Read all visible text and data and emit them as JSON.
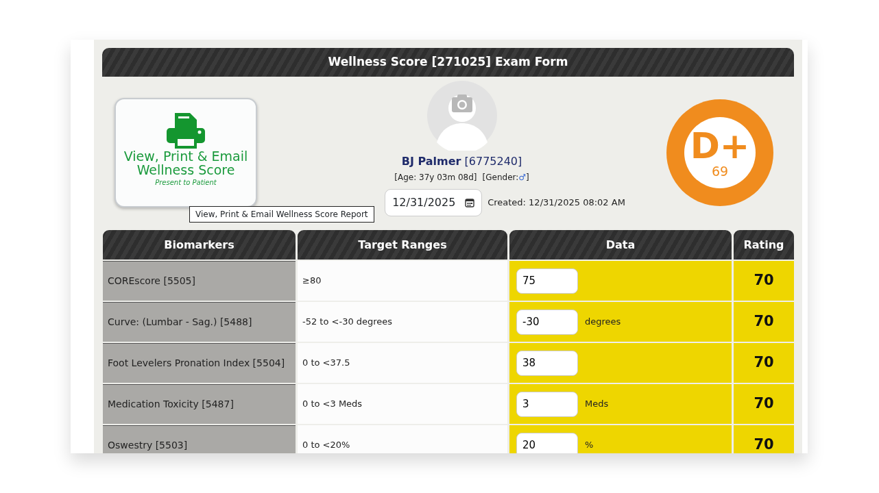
{
  "form_title": "Wellness Score [271025] Exam Form",
  "report_button": {
    "title": "View, Print & Email Wellness Score",
    "subtitle": "Present to Patient"
  },
  "tooltip": "View, Print & Email Wellness Score Report",
  "patient": {
    "name": "BJ Palmer",
    "id": "[6775240]",
    "age": "[Age: 37y 03m 08d]",
    "gender_prefix": "[Gender:",
    "gender_symbol": "♂",
    "gender_suffix": "]"
  },
  "exam_date": {
    "value": "12/31/2025"
  },
  "created": "Created: 12/31/2025 08:02 AM",
  "grade": {
    "letter": "D+",
    "score": "69",
    "color": "#f08c1e"
  },
  "table": {
    "columns": [
      "Biomarkers",
      "Target Ranges",
      "Data",
      "Rating"
    ],
    "rows": [
      {
        "biomarker": "COREscore [5505]",
        "target": "≥80",
        "value": "75",
        "rating": "70",
        "color": "#eed600"
      },
      {
        "biomarker": "Curve: (Lumbar - Sag.) [5488]",
        "target": "-52 to <-30 degrees",
        "value": "-30",
        "unit": "degrees",
        "rating": "70",
        "color": "#eed600"
      },
      {
        "biomarker": "Foot Levelers Pronation Index [5504]",
        "target": "0 to <37.5",
        "value": "38",
        "rating": "70",
        "color": "#eed600"
      },
      {
        "biomarker": "Medication Toxicity [5487]",
        "target": "0 to <3 Meds",
        "value": "3",
        "unit": "Meds",
        "rating": "70",
        "color": "#eed600"
      },
      {
        "biomarker": "Oswestry [5503]",
        "target": "0 to <20%",
        "value": "20",
        "unit": "%",
        "rating": "70",
        "color": "#eed600"
      }
    ]
  }
}
